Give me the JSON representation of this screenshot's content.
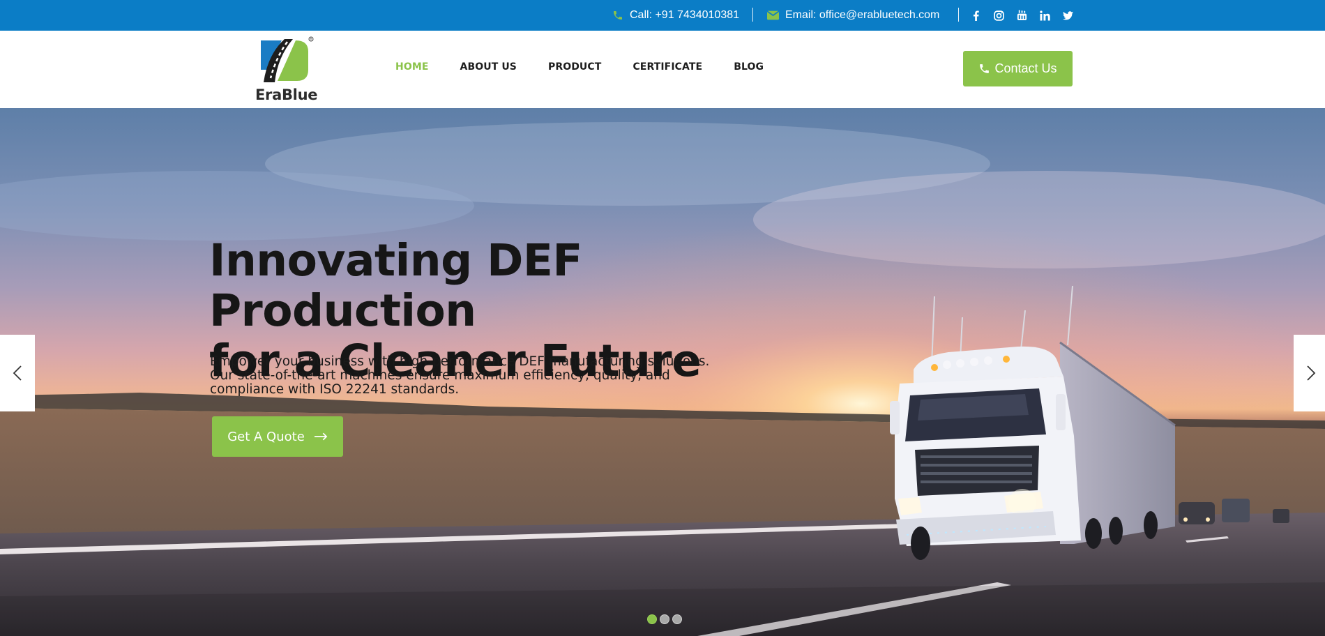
{
  "topbar": {
    "call_text": "Call: +91 7434010381",
    "email_text": "Email: office@erabluetech.com",
    "call_icon": "phone-icon",
    "email_icon": "envelope-icon",
    "socials": [
      "facebook-icon",
      "instagram-icon",
      "youtube-icon",
      "linkedin-icon",
      "twitter-icon"
    ]
  },
  "header": {
    "logo_text": "EraBlue",
    "nav": [
      {
        "label": "HOME",
        "active": true
      },
      {
        "label": "ABOUT US",
        "active": false
      },
      {
        "label": "PRODUCT",
        "active": false
      },
      {
        "label": "CERTIFICATE",
        "active": false
      },
      {
        "label": "BLOG",
        "active": false
      }
    ],
    "contact_label": "Contact Us"
  },
  "hero": {
    "title_line1": "Innovating DEF Production",
    "title_line2": "for a Cleaner Future",
    "desc_line1": "Empower your business with high-performance DEF manufacturing solutions.",
    "desc_line2": "Our state-of-the-art machines ensure maximum efficiency, quality, and",
    "desc_line3": "compliance with ISO 22241 standards.",
    "cta_label": "Get A Quote",
    "slides_total": 3,
    "active_slide": 1
  },
  "colors": {
    "topbar_bg": "#0b7dc6",
    "accent_green": "#8bc34a",
    "nav_text": "#1d1d1d"
  }
}
